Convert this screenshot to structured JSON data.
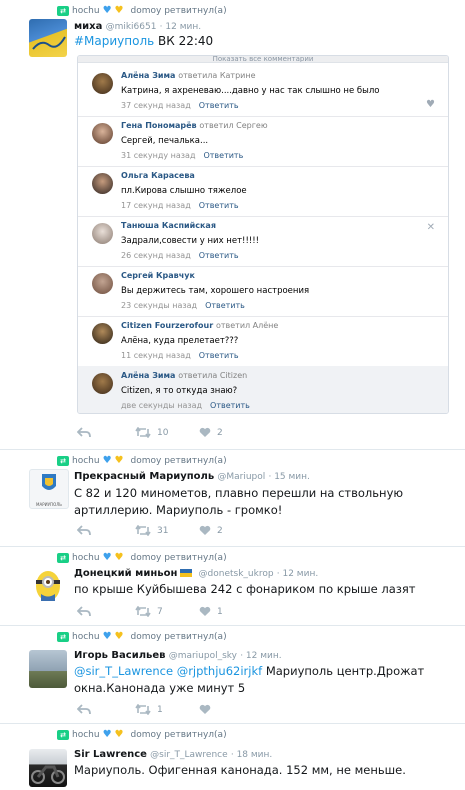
{
  "retweeter_prefix": "hochu",
  "retweeted_suffix": "domoy ретвитнул(а)",
  "tweets": [
    {
      "name": "миха",
      "handle": "@miki6651",
      "time": "· 12 мин.",
      "text_parts": [
        "#Мариуполь",
        " ВК  22:40"
      ],
      "card": {
        "top_label": "Показать все комментарии",
        "comments": [
          {
            "name": "Алёна Зима",
            "reply": "ответила Катрине",
            "text": "Катрина, я ахреневаю....давно у нас так слышно не было",
            "time": "37 секунд назад",
            "answer": "Ответить"
          },
          {
            "name": "Гена Пономарёв",
            "reply": "ответил Сергею",
            "text": "Сергей, печалька...",
            "time": "31 секунду назад",
            "answer": "Ответить"
          },
          {
            "name": "Ольга Карасева",
            "reply": "",
            "text": "пл.Кирова слышно тяжелое",
            "time": "17 секунд назад",
            "answer": "Ответить"
          },
          {
            "name": "Танюша Каспийская",
            "reply": "",
            "text": "Задрали,совести у них нет!!!!!",
            "time": "26 секунд назад",
            "answer": "Ответить"
          },
          {
            "name": "Сергей Кравчук",
            "reply": "",
            "text": "Вы держитесь там, хорошего настроения",
            "time": "23 секунды назад",
            "answer": "Ответить"
          },
          {
            "name": "Citizen Fourzerofour",
            "reply": "ответил Алёне",
            "text": "Алёна, куда прелетает???",
            "time": "11 секунд назад",
            "answer": "Ответить"
          },
          {
            "name": "Алёна Зима",
            "reply": "ответила Citizen",
            "text": "Citizen, я то откуда знаю?",
            "time": "две секунды назад",
            "answer": "Ответить"
          }
        ]
      },
      "retweets": "10",
      "likes": "2"
    },
    {
      "name": "Прекрасный Мариуполь",
      "handle": "@Mariupol",
      "time": "· 15 мин.",
      "text": "С 82 и 120 минометов, плавно перешли на ствольную артиллерию. Мариуполь - громко!",
      "avatar_caption": "МАРИУПОЛЬ",
      "retweets": "31",
      "likes": "2"
    },
    {
      "name": "Донецкий миньон",
      "handle": "@donetsk_ukrop",
      "time": "· 12 мин.",
      "text": "по крыше Куйбышева 242 с фонариком по крыше лазят",
      "retweets": "7",
      "likes": "1"
    },
    {
      "name": "Игорь Васильев",
      "handle": "@mariupol_sky",
      "time": "· 12 мин.",
      "links": [
        "@sir_T_Lawrence",
        "@rjpthju62irjkf"
      ],
      "text": " Мариуполь центр.Дрожат окна.Канонада уже минут 5",
      "retweets": "1",
      "likes": ""
    },
    {
      "name": "Sir Lawrence",
      "handle": "@sir_T_Lawrence",
      "time": "· 18 мин.",
      "text": "Мариуполь. Офигенная канонада. 152 мм, не меньше."
    }
  ],
  "colors": {
    "retweet_green": "#19cf86",
    "link_blue": "#1b95e0",
    "vk_blue": "#2a5885"
  }
}
